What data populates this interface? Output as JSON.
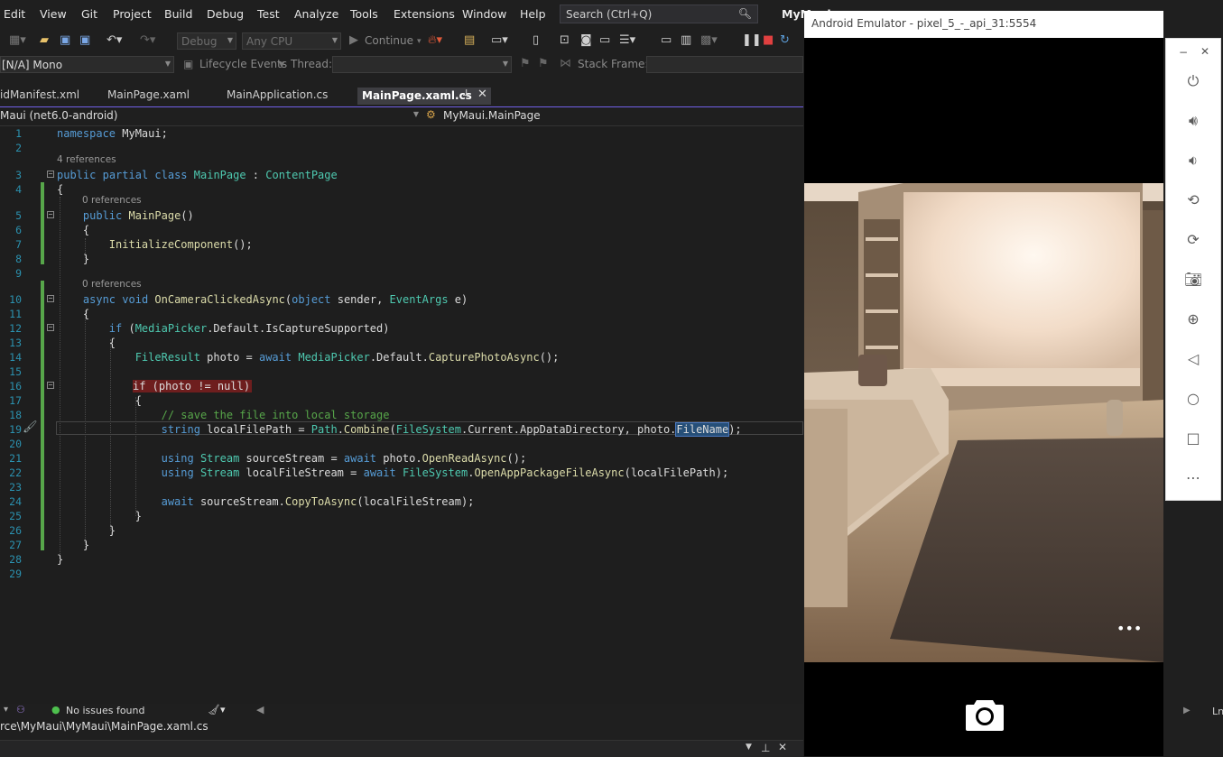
{
  "menu": [
    "Edit",
    "View",
    "Git",
    "Project",
    "Build",
    "Debug",
    "Test",
    "Analyze",
    "Tools",
    "Extensions",
    "Window",
    "Help"
  ],
  "search": {
    "placeholder": "Search (Ctrl+Q)"
  },
  "app_title": "MyMaui",
  "toolbar": {
    "config": "Debug",
    "platform": "Any CPU",
    "continue_label": "Continue",
    "process": "[N/A] Mono",
    "lifecycle_label": "Lifecycle Events",
    "thread_label": "Thread:",
    "stackframe_label": "Stack Frame:"
  },
  "tabs": [
    {
      "label": "idManifest.xml",
      "active": false
    },
    {
      "label": "MainPage.xaml",
      "active": false
    },
    {
      "label": "MainApplication.cs",
      "active": false
    },
    {
      "label": "MainPage.xaml.cs",
      "active": true
    }
  ],
  "navbar": {
    "project": "Maui (net6.0-android)",
    "member": "MyMaui.MainPage"
  },
  "code_lines": [
    {
      "n": "1",
      "t": "namespace MyMaui;"
    },
    {
      "n": "2",
      "t": ""
    },
    {
      "n": "3",
      "t": "public partial class MainPage : ContentPage"
    },
    {
      "n": "4",
      "t": "{"
    },
    {
      "n": "5",
      "t": "    public MainPage()"
    },
    {
      "n": "6",
      "t": "    {"
    },
    {
      "n": "7",
      "t": "        InitializeComponent();"
    },
    {
      "n": "8",
      "t": "    }"
    },
    {
      "n": "9",
      "t": ""
    },
    {
      "n": "10",
      "t": "    async void OnCameraClickedAsync(object sender, EventArgs e)"
    },
    {
      "n": "11",
      "t": "    {"
    },
    {
      "n": "12",
      "t": "        if (MediaPicker.Default.IsCaptureSupported)"
    },
    {
      "n": "13",
      "t": "        {"
    },
    {
      "n": "14",
      "t": "            FileResult photo = await MediaPicker.Default.CapturePhotoAsync();"
    },
    {
      "n": "15",
      "t": ""
    },
    {
      "n": "16",
      "t": "            if (photo != null)"
    },
    {
      "n": "17",
      "t": "            {"
    },
    {
      "n": "18",
      "t": "                // save the file into local storage"
    },
    {
      "n": "19",
      "t": "                string localFilePath = Path.Combine(FileSystem.Current.AppDataDirectory, photo.FileName);"
    },
    {
      "n": "20",
      "t": ""
    },
    {
      "n": "21",
      "t": "                using Stream sourceStream = await photo.OpenReadAsync();"
    },
    {
      "n": "22",
      "t": "                using Stream localFileStream = await FileSystem.OpenAppPackageFileAsync(localFilePath);"
    },
    {
      "n": "23",
      "t": ""
    },
    {
      "n": "24",
      "t": "                await sourceStream.CopyToAsync(localFileStream);"
    },
    {
      "n": "25",
      "t": "            }"
    },
    {
      "n": "26",
      "t": "        }"
    },
    {
      "n": "27",
      "t": "    }"
    },
    {
      "n": "28",
      "t": "}"
    },
    {
      "n": "29",
      "t": ""
    }
  ],
  "codelens": {
    "class_refs": "4 references",
    "ctor_refs": "0 references",
    "method_refs": "0 references"
  },
  "status": {
    "issues": "No issues found"
  },
  "path": "rce\\MyMaui\\MyMaui\\MainPage.xaml.cs",
  "emulator": {
    "title": "Android Emulator - pixel_5_-_api_31:5554",
    "more": "•••"
  },
  "status_right": "Ln",
  "colors": {
    "accent": "#7160e8",
    "breakpoint_hl": "#6e1e1e",
    "selection": "#264f78",
    "change_bar": "#57a64a"
  },
  "icons": [
    "power-icon",
    "volume-up-icon",
    "volume-down-icon",
    "rotate-left-icon",
    "rotate-right-icon",
    "camera-icon",
    "zoom-icon",
    "back-icon",
    "home-icon",
    "overview-icon",
    "more-icon"
  ]
}
